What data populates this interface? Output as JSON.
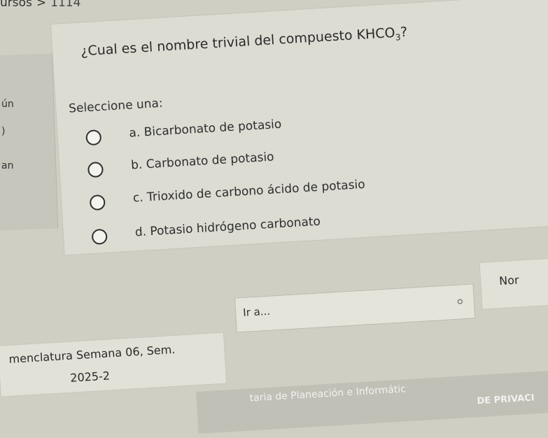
{
  "breadcrumb": {
    "item": "ursos",
    "separator": ">",
    "cut": "1114"
  },
  "sidebar": {
    "fragments": [
      "ún",
      ")",
      "an"
    ]
  },
  "question": {
    "text_before": "¿Cual es el nombre trivial del compuesto KHCO",
    "subscript": "3",
    "text_after": "?"
  },
  "answer": {
    "prompt": "Seleccione una:",
    "options": [
      {
        "label": "a. Bicarbonato de potasio"
      },
      {
        "label": "b. Carbonato de potasio"
      },
      {
        "label": "c. Trioxido de carbono ácido de potasio"
      },
      {
        "label": "d. Potasio hidrógeno carbonato"
      }
    ]
  },
  "navigation": {
    "prev_line1": "menclatura Semana 06, Sem.",
    "prev_line2": "2025-2",
    "jump_value": "Ir a...",
    "next_label": "Nor"
  },
  "footer": {
    "line1": "taria de Planeación e Informátic",
    "line2": "DE PRIVACI"
  }
}
